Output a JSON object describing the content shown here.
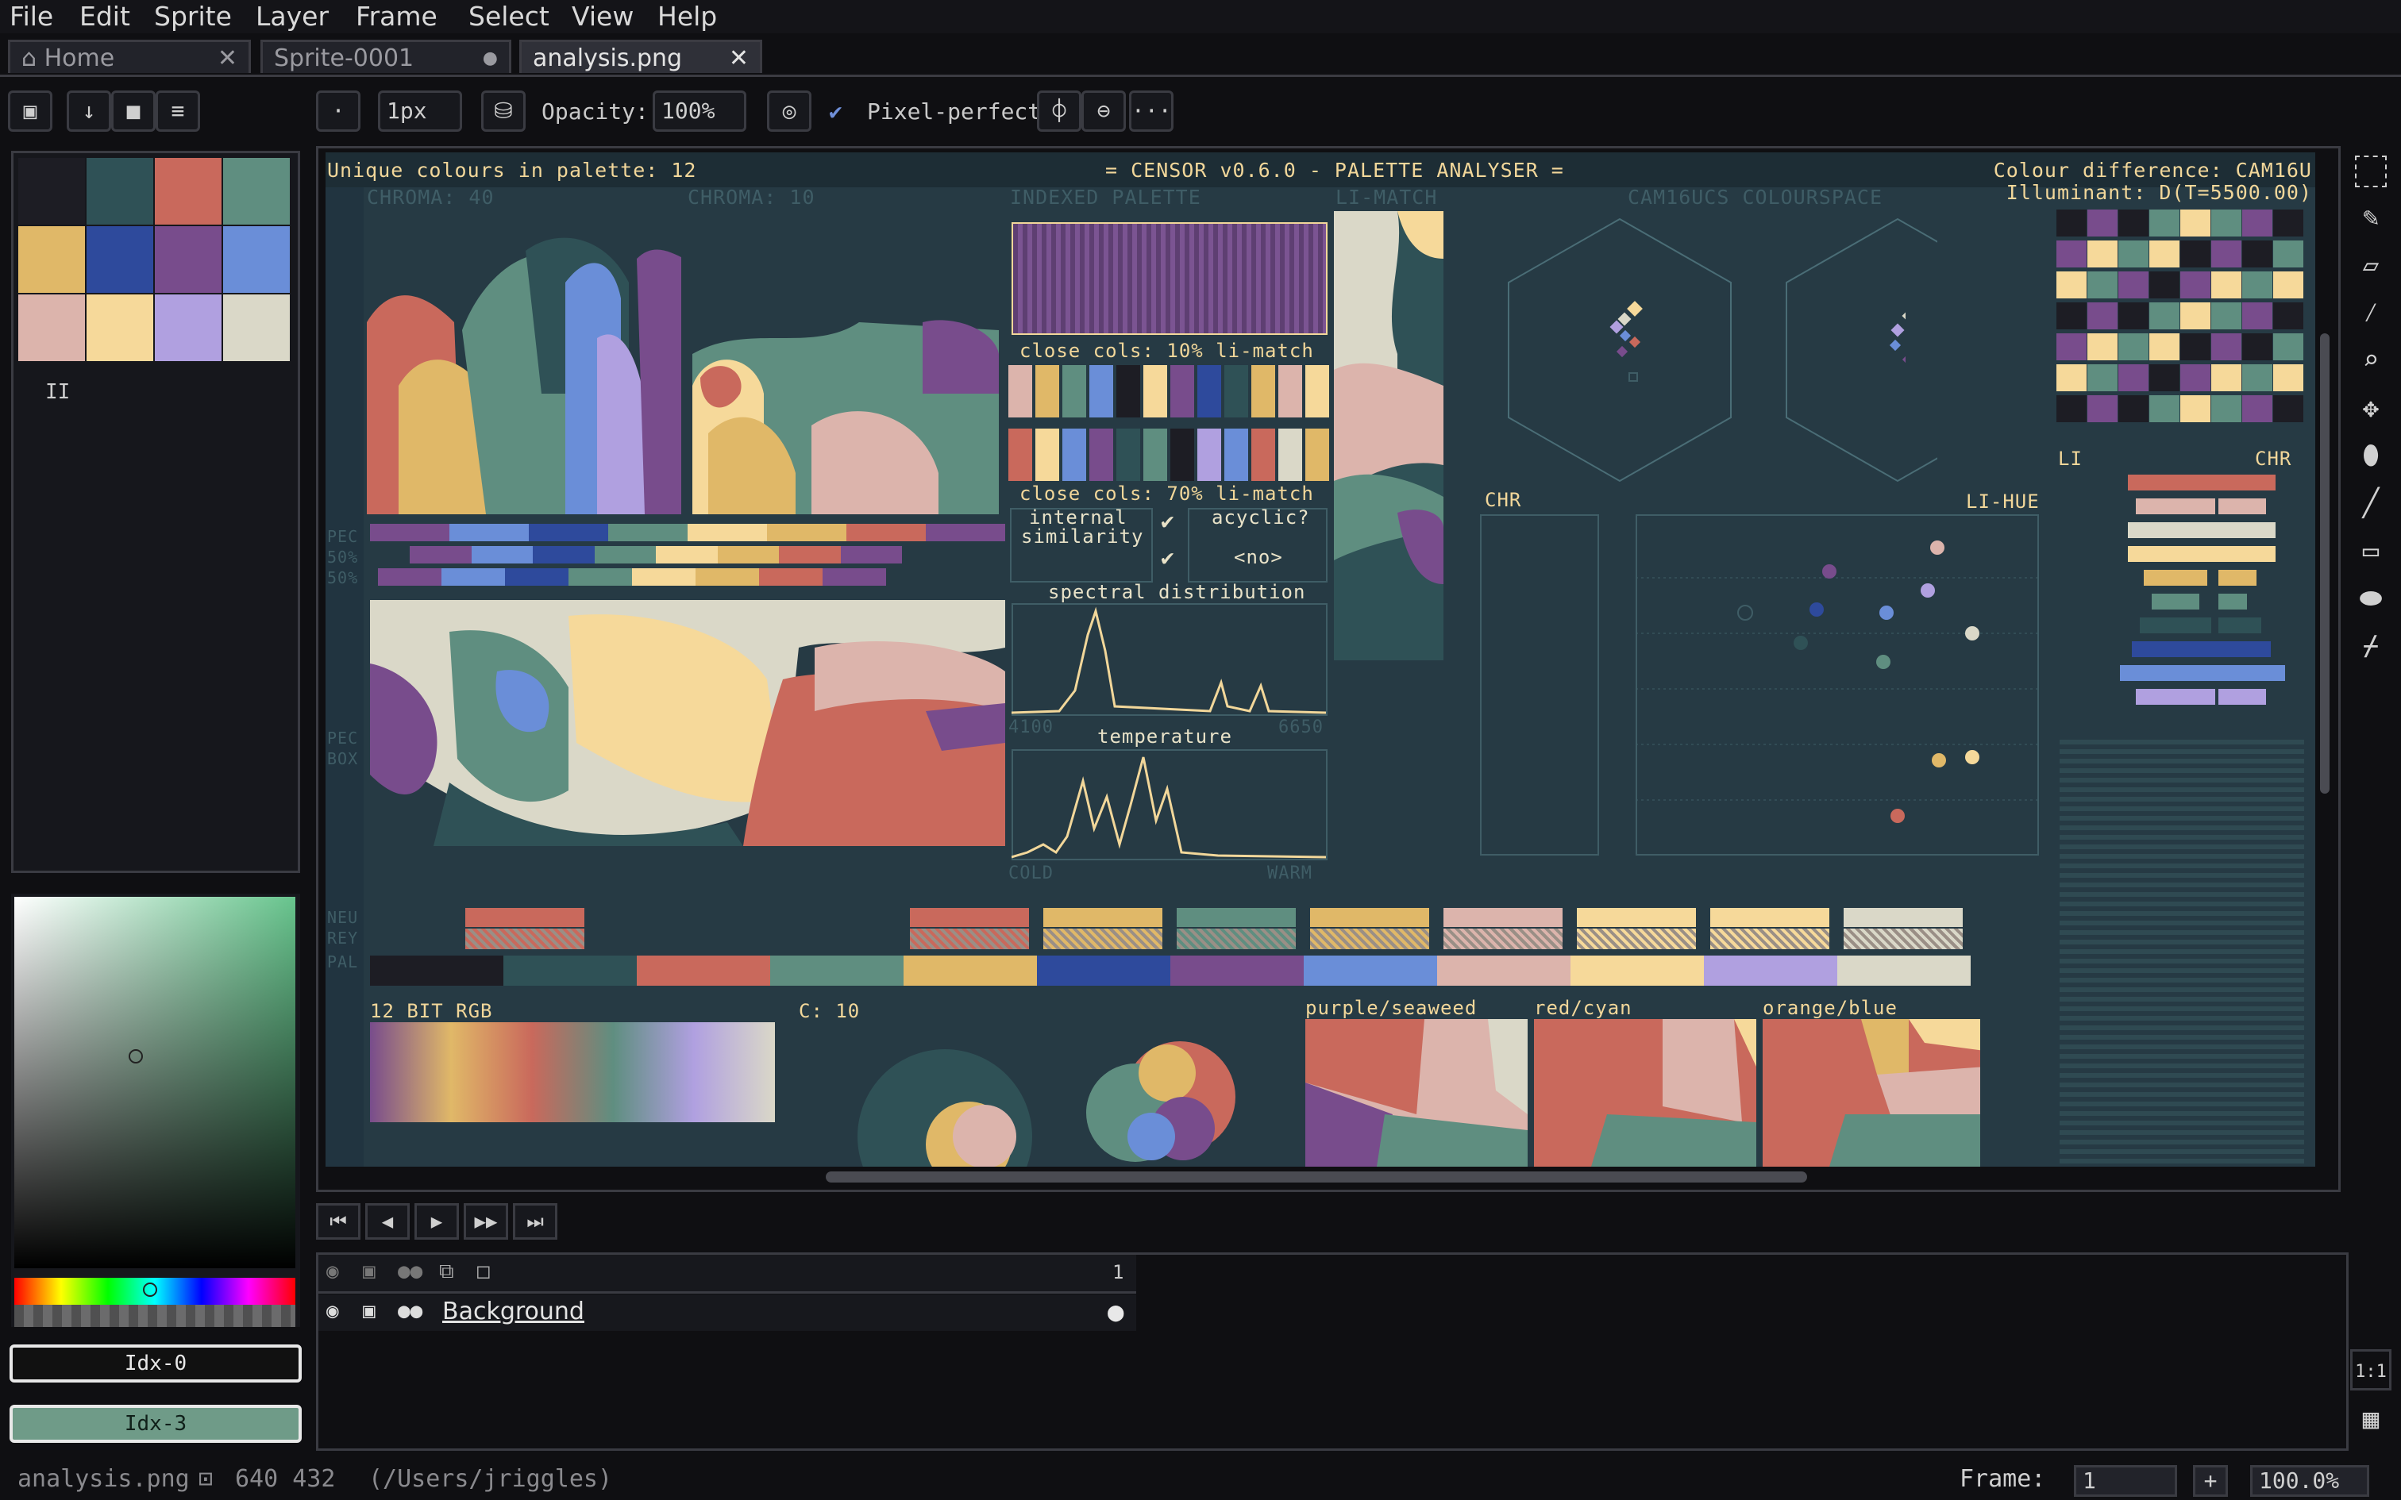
{
  "menu": [
    "File",
    "Edit",
    "Sprite",
    "Layer",
    "Frame",
    "Select",
    "View",
    "Help"
  ],
  "tabs": [
    {
      "label": "Home",
      "close": "✕"
    },
    {
      "label": "Sprite-0001",
      "close": "●"
    },
    {
      "label": "analysis.png",
      "close": "✕"
    }
  ],
  "toolbar": {
    "brush_size": "1px",
    "opacity_label": "Opacity:",
    "opacity_value": "100%",
    "pixel_perfect_label": "Pixel-perfect",
    "pixel_perfect_checked": true,
    "more": "···"
  },
  "palette": {
    "colors": [
      "#1d1d24",
      "#2f5156",
      "#c9695c",
      "#5f8e80",
      "#e0b868",
      "#2e4a9c",
      "#784c8c",
      "#6a8ed8",
      "#dcb4ac",
      "#f6d99a",
      "#b0a0e0",
      "#dad8c8"
    ],
    "mode_icon": "II"
  },
  "color_picker": {
    "fg_label": "Idx-0",
    "bg_label": "Idx-3",
    "bg_color": "#6f9b88",
    "accent": "#67c48d"
  },
  "canvas": {
    "header_left": "Unique colours in palette: 12",
    "header_center": "= CENSOR v0.6.0 - PALETTE ANALYSER =",
    "header_right_1": "Colour difference: CAM16U",
    "header_right_2": "Illuminant: D(T=5500.00)",
    "labels": {
      "chroma40": "CHROMA: 40",
      "chroma10": "CHROMA: 10",
      "indexed": "INDEXED PALETTE",
      "limatch": "LI-MATCH",
      "cam16": "CAM16UCS COLOURSPACE",
      "close10": "close cols: 10% li-match",
      "close70": "close cols: 70% li-match",
      "internal": "internal",
      "similarity": "similarity",
      "acyclic": "acyclic?",
      "no": "<no>",
      "spectral": "spectral distribution",
      "s_min": "4100",
      "s_max": "6650",
      "temperature": "temperature",
      "cold": "COLD",
      "warm": "WARM",
      "chr": "CHR",
      "lihue": "LI-HUE",
      "li": "LI",
      "chr2": "CHR",
      "pec": "PEC",
      "pct50a": "50%",
      "pct50b": "50%",
      "pec2": "PEC",
      "box": "BOX",
      "neu": "NEU",
      "rey": "REY",
      "pal": "PAL",
      "bit12": "12 BIT RGB",
      "c10": "C: 10",
      "purple": "purple/seaweed",
      "redcyan": "red/cyan",
      "orangeblue": "orange/blue"
    }
  },
  "frame_controls": [
    "⏮",
    "◀",
    "▶",
    "▶▶",
    "⏭"
  ],
  "layers": {
    "frame_number": "1",
    "layer_name": "Background"
  },
  "status": {
    "filename": "analysis.png",
    "size": "640 432",
    "path": "(/Users/jriggles)",
    "frame_label": "Frame:",
    "frame_value": "1",
    "zoom": "100.0%",
    "one_to_one": "1:1"
  }
}
